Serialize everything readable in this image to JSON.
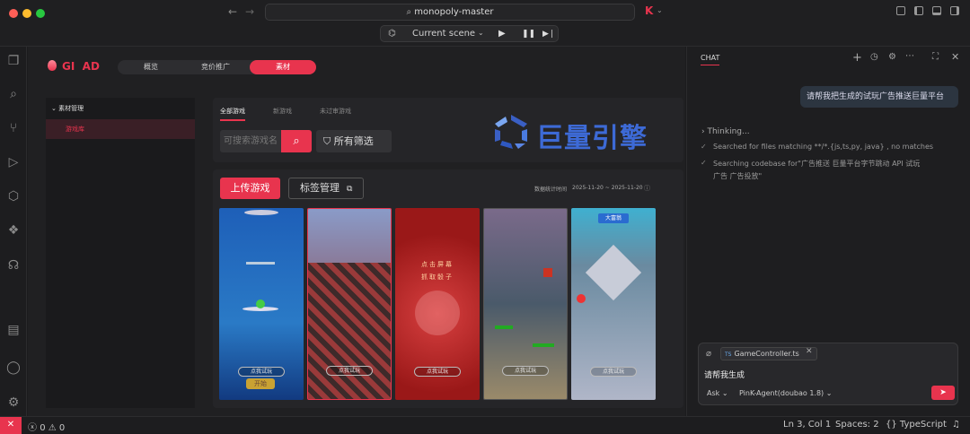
{
  "window": {
    "address": "monopoly-master",
    "scene_label": "Current scene",
    "brand_letter": "K"
  },
  "app": {
    "logo": "GI  AD",
    "tabs": [
      "概览",
      "竞价推广",
      "素材"
    ],
    "sidebar": {
      "section": "素材管理",
      "item": "游戏库"
    },
    "filter_tabs": [
      "全部游戏",
      "新游戏",
      "未过审游戏"
    ],
    "search_placeholder": "可搜索游戏名",
    "filter_label": "所有筛选",
    "engine_name": "巨量引擎",
    "upload_button": "上传游戏",
    "tag_button": "标签管理",
    "stats_label": "数据统计时间",
    "date_range": "2025-11-20 ~ 2025-11-20",
    "card_try": "点我试玩",
    "card1_extra": "开始",
    "card3_text": [
      "点击屏幕",
      "抓取骰子"
    ],
    "card5_title": "大富翁"
  },
  "chat": {
    "header": "CHAT",
    "user_msg": "请帮我把生成的试玩广告推送巨量平台",
    "thinking": "Thinking...",
    "step1": "Searched for files matching **/*.{js,ts,py, java} , no matches",
    "step2": "Searching codebase for\"广告推送 巨量平台字节跳动 API 试玩",
    "step2b": "广告 广告投放\"",
    "file_chip": "GameController.ts",
    "file_chip_badge": "TS",
    "input_text": "请帮我生成",
    "mode": "Ask",
    "agent": "PinK-Agent(doubao 1.8)"
  },
  "status": {
    "errors": "0",
    "warnings": "0",
    "position": "Ln 3, Col 1",
    "spaces": "Spaces: 2",
    "language": "TypeScript"
  },
  "colors": {
    "accent": "#e8344e",
    "bg": "#1b1b1d"
  }
}
